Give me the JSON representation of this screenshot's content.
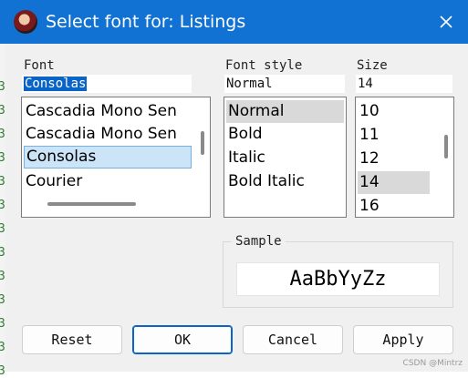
{
  "window": {
    "title": "Select font for: Listings",
    "close_glyph": "✕"
  },
  "font": {
    "label": "Font",
    "value": "Consolas",
    "items": [
      "Cascadia Mono Sen",
      "Cascadia Mono Sen",
      "Consolas",
      "Courier"
    ],
    "selected_index": 2
  },
  "font_style": {
    "label": "Font style",
    "value": "Normal",
    "items": [
      "Normal",
      "Bold",
      "Italic",
      "Bold Italic"
    ],
    "selected_index": 0
  },
  "size": {
    "label": "Size",
    "value": "14",
    "items": [
      "10",
      "11",
      "12",
      "14",
      "16"
    ],
    "selected_index": 3
  },
  "sample": {
    "label": "Sample",
    "text": "AaBbYyZz"
  },
  "buttons": {
    "reset": "Reset",
    "ok": "OK",
    "cancel": "Cancel",
    "apply": "Apply"
  },
  "background": {
    "edge_marks": [
      "3",
      "3",
      "3",
      "3",
      "3",
      "3",
      "3",
      "3",
      "3",
      "3",
      "3",
      "3",
      "3"
    ]
  },
  "watermark": "CSDN @Mintrz"
}
